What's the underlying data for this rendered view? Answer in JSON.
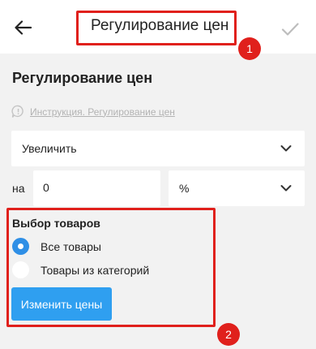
{
  "header": {
    "title": "Регулирование цен",
    "back_icon": "arrow-left-icon",
    "confirm_icon": "checkmark-icon"
  },
  "form": {
    "title": "Регулирование цен",
    "help_link": "Инструкция. Регулирование цен",
    "direction_select": {
      "value": "Увеличить"
    },
    "amount_label": "на",
    "amount_value": "0",
    "unit_select": {
      "value": "%"
    }
  },
  "products": {
    "title": "Выбор товаров",
    "options": [
      {
        "label": "Все товары",
        "checked": true
      },
      {
        "label": "Товары из категорий",
        "checked": false
      }
    ],
    "apply_button": "Изменить цены"
  },
  "annotations": {
    "badge_1": "1",
    "badge_2": "2",
    "color": "#e0201c"
  },
  "colors": {
    "accent": "#2f9ff0",
    "radio_checked": "#2f8fe6",
    "background": "#f2f2f2"
  }
}
